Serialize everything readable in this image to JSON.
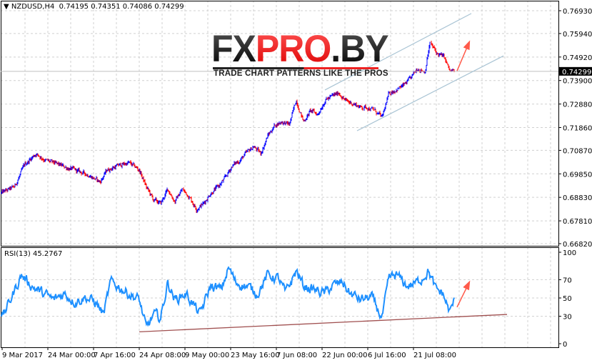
{
  "header": {
    "symbol_line": "▼ NZDUSD,H4  0.74195 0.74351 0.74086 0.74299"
  },
  "logo": {
    "brand_dark1": "FX",
    "brand_red": "PRO",
    "brand_dark2": ".BY",
    "tagline": "TRADE CHART PATTERNS LIKE THE PROS"
  },
  "colors": {
    "up": "#0000ff",
    "down": "#ff0000",
    "rsi": "#1e90ff",
    "channel": "#a9c4d4",
    "rsi_trend": "#a05050",
    "arrow": "#ff5a4a",
    "grid": "#d0d0d0"
  },
  "chart_data": [
    {
      "type": "line",
      "title": "NZDUSD,H4",
      "ohlc_last": {
        "open": 0.74195,
        "high": 0.74351,
        "low": 0.74086,
        "close": 0.74299
      },
      "current_price_label": "0.74299",
      "current_price": 0.74299,
      "ylim": [
        0.6682,
        0.7693
      ],
      "y_ticks": [
        "0.76930",
        "0.75940",
        "0.74920",
        "0.73900",
        "0.72880",
        "0.71860",
        "0.70870",
        "0.69850",
        "0.68830",
        "0.67810",
        "0.66820"
      ],
      "x_bars": [
        2,
        20,
        35,
        50,
        65,
        80,
        95,
        110,
        125,
        140,
        150,
        165,
        180,
        195,
        205,
        215,
        225,
        235,
        245,
        255,
        265,
        275,
        285,
        295,
        305,
        315,
        325,
        335,
        345,
        355,
        365,
        375,
        385,
        395,
        405,
        415,
        425,
        435,
        445,
        455,
        465,
        475,
        485,
        495,
        505,
        515,
        525,
        535,
        545,
        555,
        565,
        575,
        585,
        595,
        602,
        612,
        622,
        630,
        635
      ],
      "close_approx": [
        0.6902,
        0.6927,
        0.7026,
        0.7073,
        0.7042,
        0.7026,
        0.7011,
        0.6995,
        0.698,
        0.6949,
        0.7002,
        0.702,
        0.7033,
        0.7002,
        0.6927,
        0.6871,
        0.6856,
        0.6918,
        0.6865,
        0.6918,
        0.6887,
        0.6834,
        0.6856,
        0.6902,
        0.6927,
        0.6964,
        0.702,
        0.7042,
        0.7073,
        0.7104,
        0.7073,
        0.715,
        0.7197,
        0.7212,
        0.7197,
        0.7305,
        0.7212,
        0.7259,
        0.7243,
        0.7305,
        0.7321,
        0.7336,
        0.7299,
        0.729,
        0.7274,
        0.7274,
        0.7259,
        0.7228,
        0.7336,
        0.7352,
        0.7367,
        0.7398,
        0.7445,
        0.7429,
        0.7553,
        0.7507,
        0.7491,
        0.7429,
        0.743
      ],
      "channel_upper": {
        "bar": [
          455,
          660
        ],
        "price": [
          0.7349,
          0.7681
        ]
      },
      "channel_lower": {
        "bar": [
          500,
          705
        ],
        "price": [
          0.7172,
          0.7497
        ]
      },
      "arrow": {
        "bar": [
          640,
          657
        ],
        "price": [
          0.7432,
          0.7556
        ]
      }
    },
    {
      "type": "line",
      "title": "RSI(13) 45.2767",
      "ylim": [
        0,
        100
      ],
      "y_ticks": [
        "100",
        "70",
        "50",
        "30",
        "0"
      ],
      "levels": [
        70,
        50,
        30
      ],
      "x_bars": [
        2,
        10,
        30,
        45,
        60,
        75,
        90,
        105,
        120,
        135,
        145,
        155,
        165,
        180,
        195,
        205,
        215,
        225,
        235,
        245,
        260,
        270,
        280,
        295,
        310,
        320,
        330,
        345,
        360,
        375,
        390,
        400,
        415,
        425,
        440,
        455,
        465,
        480,
        490,
        505,
        520,
        535,
        545,
        555,
        570,
        585,
        600,
        610,
        620,
        630,
        635
      ],
      "values": [
        27,
        40,
        75,
        63,
        55,
        48,
        55,
        46,
        51,
        44,
        32,
        67,
        63,
        55,
        48,
        16,
        32,
        28,
        67,
        48,
        55,
        44,
        32,
        63,
        59,
        83,
        67,
        63,
        55,
        75,
        71,
        55,
        80,
        63,
        59,
        55,
        63,
        67,
        55,
        48,
        51,
        28,
        71,
        75,
        63,
        67,
        80,
        59,
        55,
        34,
        45
      ],
      "trendline": {
        "bar": [
          195,
          710
        ],
        "value": [
          13,
          32
        ]
      },
      "arrow": {
        "bar": [
          640,
          657
        ],
        "value": [
          40,
          67
        ]
      }
    }
  ],
  "x_axis": {
    "labels": [
      "9 Mar 2017",
      "24 Mar 00:00",
      "7 Apr 16:00",
      "24 Apr 08:00",
      "9 May 00:00",
      "23 May 16:00",
      "7 Jun 08:00",
      "22 Jun 00:00",
      "6 Jul 16:00",
      "21 Jul 08:00"
    ]
  }
}
